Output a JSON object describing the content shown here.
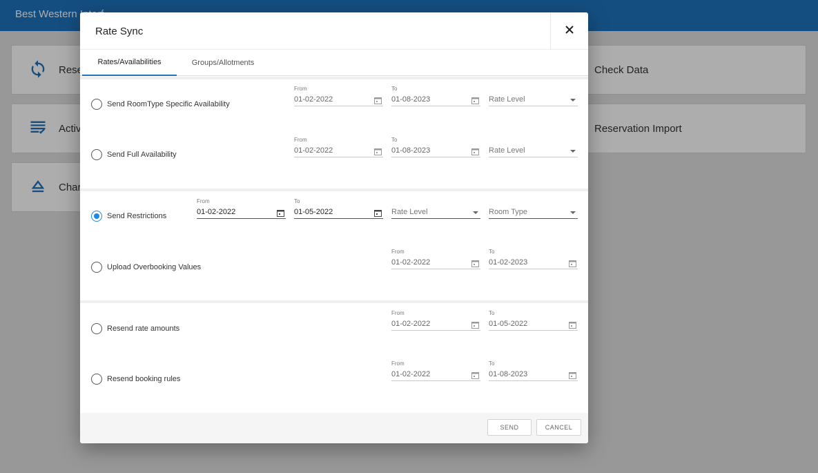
{
  "app": {
    "brand": "Best Western Interf",
    "tiles": [
      {
        "label": "Rese",
        "icon": "sync-icon"
      },
      {
        "label": "Activ",
        "icon": "list-check-icon"
      },
      {
        "label": "Char",
        "icon": "eject-icon"
      },
      {
        "label": "Check Data",
        "icon": ""
      },
      {
        "label": "Reservation Import",
        "icon": ""
      }
    ]
  },
  "dialog": {
    "title": "Rate Sync",
    "tabs": [
      "Rates/Availabilities",
      "Groups/Allotments"
    ],
    "active_tab": 0,
    "rows": [
      {
        "label": "Send RoomType Specific Availability",
        "checked": false,
        "from_label": "From",
        "from": "01-02-2022",
        "to_label": "To",
        "to": "01-08-2023",
        "select1": "Rate Level"
      },
      {
        "label": "Send Full Availability",
        "checked": false,
        "from_label": "From",
        "from": "01-02-2022",
        "to_label": "To",
        "to": "01-08-2023",
        "select1": "Rate Level"
      },
      {
        "label": "Send Restrictions",
        "checked": true,
        "from_label": "From",
        "from": "01-02-2022",
        "to_label": "To",
        "to": "01-05-2022",
        "select1": "Rate Level",
        "select2": "Room Type"
      },
      {
        "label": "Upload Overbooking Values",
        "checked": false,
        "from_label": "From",
        "from": "01-02-2022",
        "to_label": "To",
        "to": "01-02-2023"
      },
      {
        "label": "Resend rate amounts",
        "checked": false,
        "from_label": "From",
        "from": "01-02-2022",
        "to_label": "To",
        "to": "01-05-2022"
      },
      {
        "label": "Resend booking rules",
        "checked": false,
        "from_label": "From",
        "from": "01-02-2022",
        "to_label": "To",
        "to": "01-08-2023"
      }
    ],
    "send_label": "SEND",
    "cancel_label": "CANCEL"
  },
  "colors": {
    "accent": "#1e73be",
    "radio_checked": "#1e88e5"
  }
}
